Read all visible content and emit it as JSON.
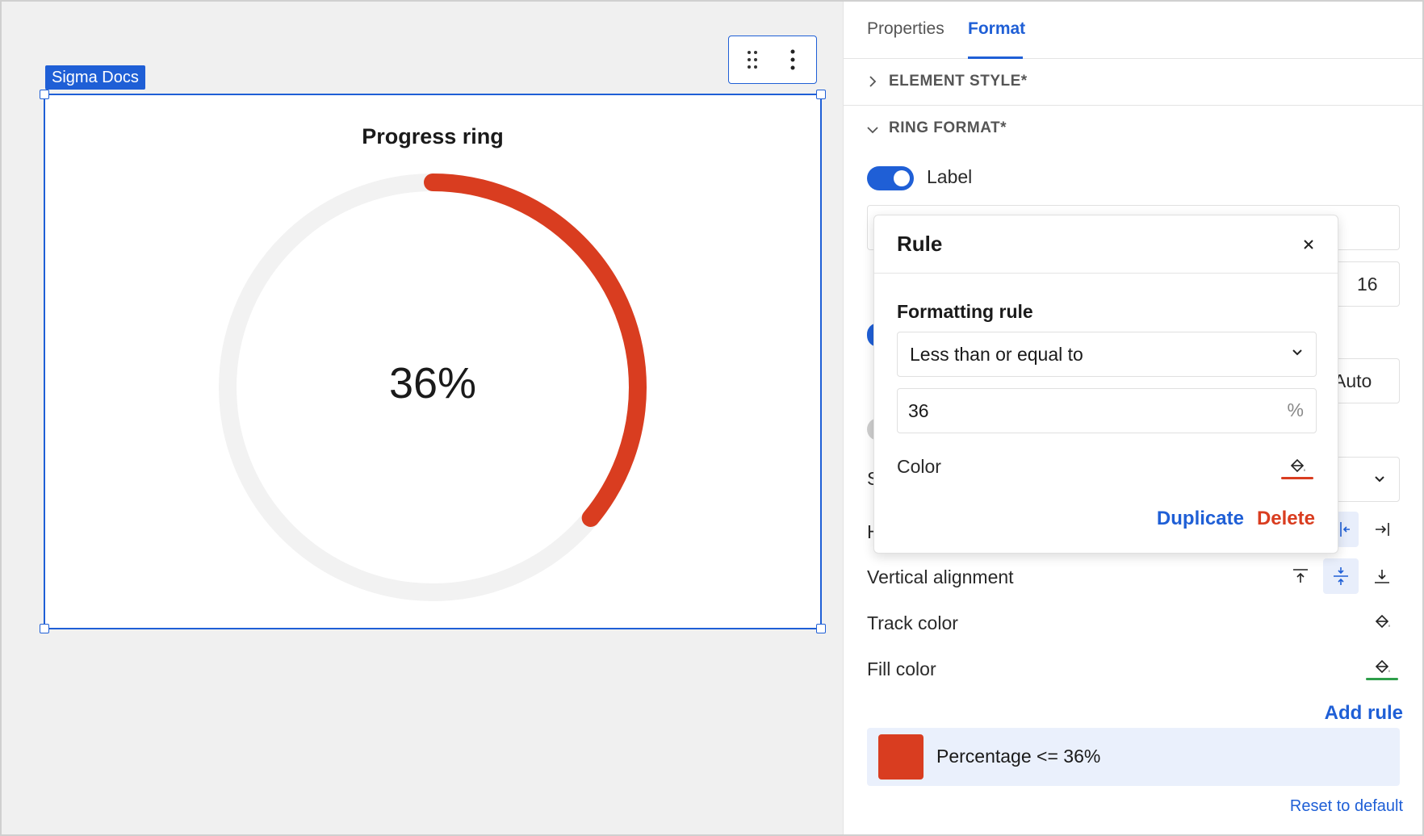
{
  "canvas": {
    "badge": "Sigma Docs",
    "element": {
      "title": "Progress ring",
      "value_label": "36%",
      "progress_percent": 36,
      "track_color": "#f2f2f2",
      "fill_color": "#d93d20"
    }
  },
  "panel": {
    "tabs": [
      {
        "label": "Properties",
        "active": false
      },
      {
        "label": "Format",
        "active": true
      }
    ],
    "sections": {
      "element_style": "ELEMENT STYLE*",
      "ring_format": "RING FORMAT*"
    },
    "label_toggle": "Label",
    "font_size_value": "16",
    "auto_value": "Auto",
    "horizontal_alignment_partial": "H",
    "style_partial": "S",
    "vertical_alignment": "Vertical alignment",
    "track_color": "Track color",
    "fill_color": "Fill color",
    "fill_color_accent": "#2e9e4a",
    "add_rule": "Add rule",
    "rule_item": {
      "text": "Percentage <= 36%",
      "color": "#d93d20"
    },
    "reset": "Reset to default"
  },
  "popover": {
    "title": "Rule",
    "formatting_rule_label": "Formatting rule",
    "condition": "Less than or equal to",
    "value": "36",
    "value_suffix": "%",
    "color_label": "Color",
    "color": "#d93d20",
    "duplicate": "Duplicate",
    "delete": "Delete"
  },
  "colors": {
    "accent": "#1f5fd6",
    "danger": "#d93d20"
  }
}
